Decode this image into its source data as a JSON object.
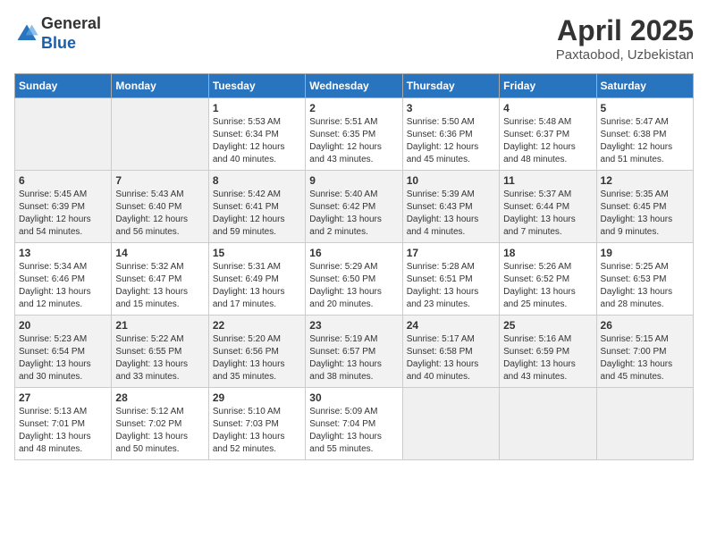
{
  "header": {
    "logo_line1": "General",
    "logo_line2": "Blue",
    "month_title": "April 2025",
    "location": "Paxtaobod, Uzbekistan"
  },
  "days_of_week": [
    "Sunday",
    "Monday",
    "Tuesday",
    "Wednesday",
    "Thursday",
    "Friday",
    "Saturday"
  ],
  "weeks": [
    [
      {
        "day": "",
        "sunrise": "",
        "sunset": "",
        "daylight": ""
      },
      {
        "day": "",
        "sunrise": "",
        "sunset": "",
        "daylight": ""
      },
      {
        "day": "1",
        "sunrise": "Sunrise: 5:53 AM",
        "sunset": "Sunset: 6:34 PM",
        "daylight": "Daylight: 12 hours and 40 minutes."
      },
      {
        "day": "2",
        "sunrise": "Sunrise: 5:51 AM",
        "sunset": "Sunset: 6:35 PM",
        "daylight": "Daylight: 12 hours and 43 minutes."
      },
      {
        "day": "3",
        "sunrise": "Sunrise: 5:50 AM",
        "sunset": "Sunset: 6:36 PM",
        "daylight": "Daylight: 12 hours and 45 minutes."
      },
      {
        "day": "4",
        "sunrise": "Sunrise: 5:48 AM",
        "sunset": "Sunset: 6:37 PM",
        "daylight": "Daylight: 12 hours and 48 minutes."
      },
      {
        "day": "5",
        "sunrise": "Sunrise: 5:47 AM",
        "sunset": "Sunset: 6:38 PM",
        "daylight": "Daylight: 12 hours and 51 minutes."
      }
    ],
    [
      {
        "day": "6",
        "sunrise": "Sunrise: 5:45 AM",
        "sunset": "Sunset: 6:39 PM",
        "daylight": "Daylight: 12 hours and 54 minutes."
      },
      {
        "day": "7",
        "sunrise": "Sunrise: 5:43 AM",
        "sunset": "Sunset: 6:40 PM",
        "daylight": "Daylight: 12 hours and 56 minutes."
      },
      {
        "day": "8",
        "sunrise": "Sunrise: 5:42 AM",
        "sunset": "Sunset: 6:41 PM",
        "daylight": "Daylight: 12 hours and 59 minutes."
      },
      {
        "day": "9",
        "sunrise": "Sunrise: 5:40 AM",
        "sunset": "Sunset: 6:42 PM",
        "daylight": "Daylight: 13 hours and 2 minutes."
      },
      {
        "day": "10",
        "sunrise": "Sunrise: 5:39 AM",
        "sunset": "Sunset: 6:43 PM",
        "daylight": "Daylight: 13 hours and 4 minutes."
      },
      {
        "day": "11",
        "sunrise": "Sunrise: 5:37 AM",
        "sunset": "Sunset: 6:44 PM",
        "daylight": "Daylight: 13 hours and 7 minutes."
      },
      {
        "day": "12",
        "sunrise": "Sunrise: 5:35 AM",
        "sunset": "Sunset: 6:45 PM",
        "daylight": "Daylight: 13 hours and 9 minutes."
      }
    ],
    [
      {
        "day": "13",
        "sunrise": "Sunrise: 5:34 AM",
        "sunset": "Sunset: 6:46 PM",
        "daylight": "Daylight: 13 hours and 12 minutes."
      },
      {
        "day": "14",
        "sunrise": "Sunrise: 5:32 AM",
        "sunset": "Sunset: 6:47 PM",
        "daylight": "Daylight: 13 hours and 15 minutes."
      },
      {
        "day": "15",
        "sunrise": "Sunrise: 5:31 AM",
        "sunset": "Sunset: 6:49 PM",
        "daylight": "Daylight: 13 hours and 17 minutes."
      },
      {
        "day": "16",
        "sunrise": "Sunrise: 5:29 AM",
        "sunset": "Sunset: 6:50 PM",
        "daylight": "Daylight: 13 hours and 20 minutes."
      },
      {
        "day": "17",
        "sunrise": "Sunrise: 5:28 AM",
        "sunset": "Sunset: 6:51 PM",
        "daylight": "Daylight: 13 hours and 23 minutes."
      },
      {
        "day": "18",
        "sunrise": "Sunrise: 5:26 AM",
        "sunset": "Sunset: 6:52 PM",
        "daylight": "Daylight: 13 hours and 25 minutes."
      },
      {
        "day": "19",
        "sunrise": "Sunrise: 5:25 AM",
        "sunset": "Sunset: 6:53 PM",
        "daylight": "Daylight: 13 hours and 28 minutes."
      }
    ],
    [
      {
        "day": "20",
        "sunrise": "Sunrise: 5:23 AM",
        "sunset": "Sunset: 6:54 PM",
        "daylight": "Daylight: 13 hours and 30 minutes."
      },
      {
        "day": "21",
        "sunrise": "Sunrise: 5:22 AM",
        "sunset": "Sunset: 6:55 PM",
        "daylight": "Daylight: 13 hours and 33 minutes."
      },
      {
        "day": "22",
        "sunrise": "Sunrise: 5:20 AM",
        "sunset": "Sunset: 6:56 PM",
        "daylight": "Daylight: 13 hours and 35 minutes."
      },
      {
        "day": "23",
        "sunrise": "Sunrise: 5:19 AM",
        "sunset": "Sunset: 6:57 PM",
        "daylight": "Daylight: 13 hours and 38 minutes."
      },
      {
        "day": "24",
        "sunrise": "Sunrise: 5:17 AM",
        "sunset": "Sunset: 6:58 PM",
        "daylight": "Daylight: 13 hours and 40 minutes."
      },
      {
        "day": "25",
        "sunrise": "Sunrise: 5:16 AM",
        "sunset": "Sunset: 6:59 PM",
        "daylight": "Daylight: 13 hours and 43 minutes."
      },
      {
        "day": "26",
        "sunrise": "Sunrise: 5:15 AM",
        "sunset": "Sunset: 7:00 PM",
        "daylight": "Daylight: 13 hours and 45 minutes."
      }
    ],
    [
      {
        "day": "27",
        "sunrise": "Sunrise: 5:13 AM",
        "sunset": "Sunset: 7:01 PM",
        "daylight": "Daylight: 13 hours and 48 minutes."
      },
      {
        "day": "28",
        "sunrise": "Sunrise: 5:12 AM",
        "sunset": "Sunset: 7:02 PM",
        "daylight": "Daylight: 13 hours and 50 minutes."
      },
      {
        "day": "29",
        "sunrise": "Sunrise: 5:10 AM",
        "sunset": "Sunset: 7:03 PM",
        "daylight": "Daylight: 13 hours and 52 minutes."
      },
      {
        "day": "30",
        "sunrise": "Sunrise: 5:09 AM",
        "sunset": "Sunset: 7:04 PM",
        "daylight": "Daylight: 13 hours and 55 minutes."
      },
      {
        "day": "",
        "sunrise": "",
        "sunset": "",
        "daylight": ""
      },
      {
        "day": "",
        "sunrise": "",
        "sunset": "",
        "daylight": ""
      },
      {
        "day": "",
        "sunrise": "",
        "sunset": "",
        "daylight": ""
      }
    ]
  ]
}
